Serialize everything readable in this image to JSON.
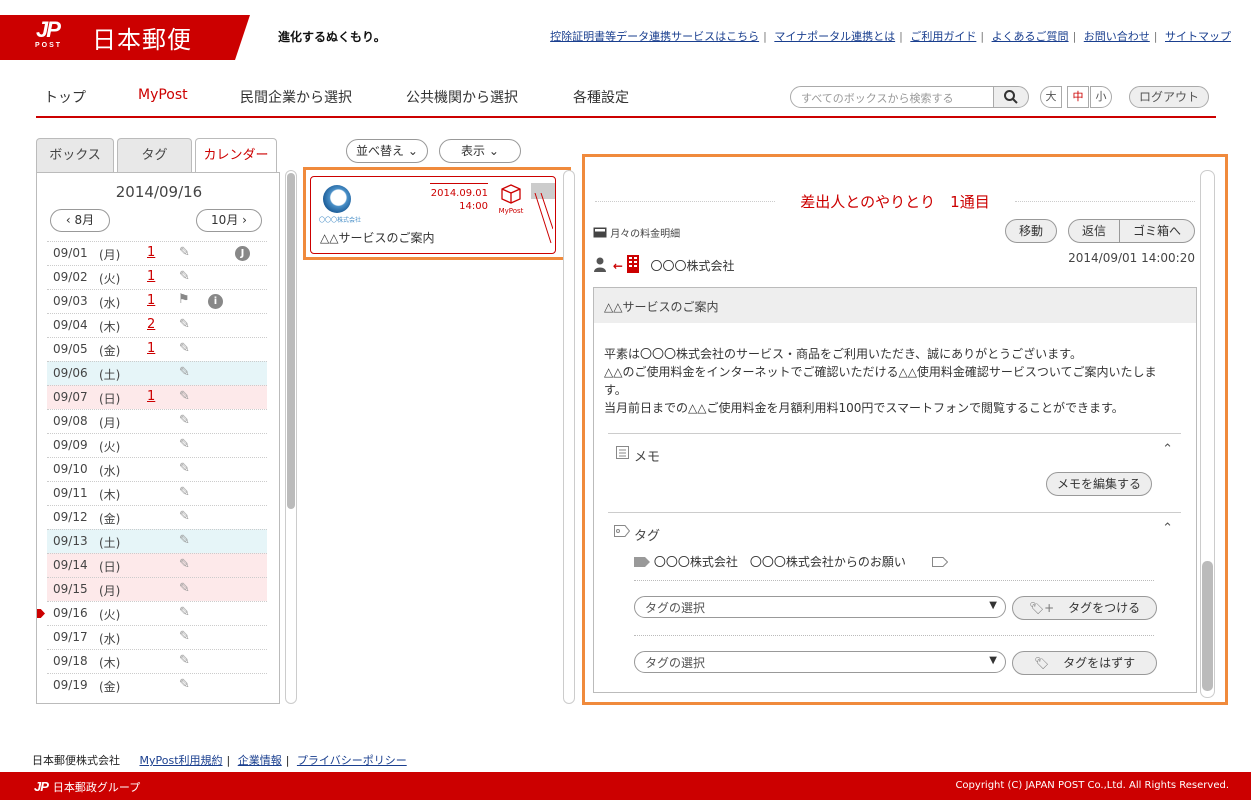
{
  "header": {
    "logo_mark": "JP",
    "logo_post": "POST",
    "logo_name": "日本郵便",
    "slogan": "進化するぬくもり。",
    "links": [
      "控除証明書等データ連携サービスはこちら",
      "マイナポータル連携とは",
      "ご利用ガイド",
      "よくあるご質問",
      "お問い合わせ",
      "サイトマップ"
    ]
  },
  "nav": {
    "items": [
      "トップ",
      "MyPost",
      "民間企業から選択",
      "公共機関から選択",
      "各種設定"
    ],
    "active": "MyPost",
    "search_placeholder": "すべてのボックスから検索する",
    "sizes": [
      "大",
      "中",
      "小"
    ],
    "size_active": "中",
    "logout": "ログアウト"
  },
  "left": {
    "tabs": [
      "ボックス",
      "タグ",
      "カレンダー"
    ],
    "active_tab": "カレンダー",
    "date": "2014/09/16",
    "prev_month": "8月",
    "next_month": "10月",
    "rows": [
      {
        "d": "09/01",
        "w": "(月)",
        "n": "1",
        "icon": "J"
      },
      {
        "d": "09/02",
        "w": "(火)",
        "n": "1"
      },
      {
        "d": "09/03",
        "w": "(水)",
        "n": "1",
        "flag": true,
        "info": "i"
      },
      {
        "d": "09/04",
        "w": "(木)",
        "n": "2"
      },
      {
        "d": "09/05",
        "w": "(金)",
        "n": "1"
      },
      {
        "d": "09/06",
        "w": "(土)",
        "n": "",
        "type": "sat"
      },
      {
        "d": "09/07",
        "w": "(日)",
        "n": "1",
        "type": "sun"
      },
      {
        "d": "09/08",
        "w": "(月)",
        "n": ""
      },
      {
        "d": "09/09",
        "w": "(火)",
        "n": ""
      },
      {
        "d": "09/10",
        "w": "(水)",
        "n": ""
      },
      {
        "d": "09/11",
        "w": "(木)",
        "n": ""
      },
      {
        "d": "09/12",
        "w": "(金)",
        "n": ""
      },
      {
        "d": "09/13",
        "w": "(土)",
        "n": "",
        "type": "sat"
      },
      {
        "d": "09/14",
        "w": "(日)",
        "n": "",
        "type": "sun"
      },
      {
        "d": "09/15",
        "w": "(月)",
        "n": "",
        "type": "sun"
      },
      {
        "d": "09/16",
        "w": "(火)",
        "n": "",
        "current": true
      },
      {
        "d": "09/17",
        "w": "(水)",
        "n": ""
      },
      {
        "d": "09/18",
        "w": "(木)",
        "n": ""
      },
      {
        "d": "09/19",
        "w": "(金)",
        "n": ""
      }
    ]
  },
  "list": {
    "sort_label": "並べ替え",
    "view_label": "表示",
    "card": {
      "company_logo_text": "〇〇〇株式会社",
      "date": "2014.09.01",
      "time": "14:00",
      "badge": "MyPost",
      "subject": "△△サービスのご案内"
    }
  },
  "detail": {
    "title": "差出人とのやりとり　1通目",
    "category": "月々の料金明細",
    "move": "移動",
    "reply": "返信",
    "trash": "ゴミ箱へ",
    "sender": "〇〇〇株式会社",
    "datetime": "2014/09/01 14:00:20",
    "subject": "△△サービスのご案内",
    "body": [
      "平素は〇〇〇株式会社のサービス・商品をご利用いただき、誠にありがとうございます。",
      "△△のご使用料金をインターネットでご確認いただける△△使用料金確認サービスついてご案内いたしま",
      "す。",
      "当月前日までの△△ご使用料金を月額利用料100円でスマートフォンで閲覧することができます。"
    ],
    "memo_label": "メモ",
    "memo_edit": "メモを編集する",
    "tag_label": "タグ",
    "tags_assigned": "〇〇〇株式会社　〇〇〇株式会社からのお願い",
    "select_placeholder": "タグの選択",
    "attach_tag": "タグをつける",
    "remove_tag": "タグをはずす"
  },
  "footer": {
    "company": "日本郵便株式会社",
    "links": [
      "MyPost利用規約",
      "企業情報",
      "プライバシーポリシー"
    ],
    "group_mark": "JP",
    "group": "日本郵政グループ",
    "copyright": "Copyright (C) JAPAN POST Co.,Ltd. All Rights Reserved."
  },
  "colors": {
    "brand": "#cc0000",
    "highlight": "#f08a3c",
    "saturday": "#e6f5f8",
    "sunday": "#fde9ea"
  }
}
